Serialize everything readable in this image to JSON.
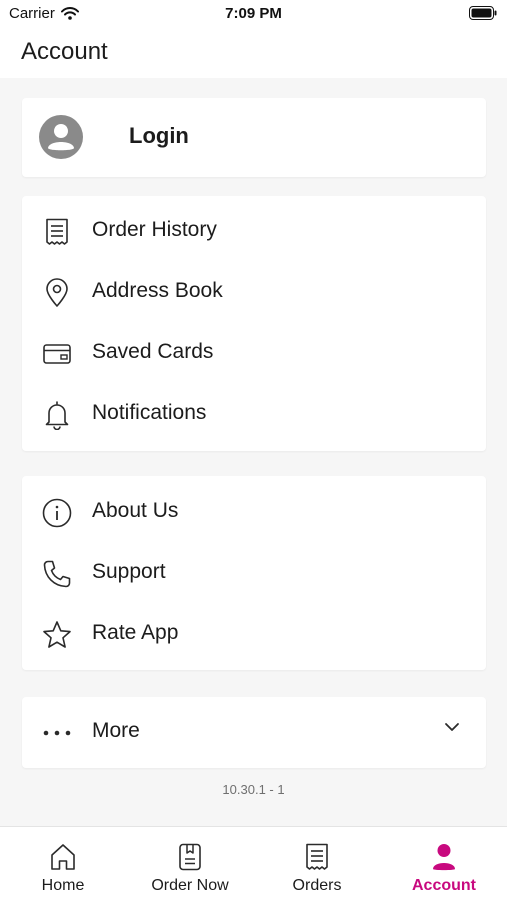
{
  "status_bar": {
    "carrier": "Carrier",
    "time": "7:09 PM"
  },
  "header": {
    "title": "Account"
  },
  "login": {
    "label": "Login"
  },
  "menu_group_1": [
    {
      "label": "Order History",
      "icon": "receipt-icon"
    },
    {
      "label": "Address Book",
      "icon": "location-pin-icon"
    },
    {
      "label": "Saved Cards",
      "icon": "credit-card-icon"
    },
    {
      "label": "Notifications",
      "icon": "bell-icon"
    }
  ],
  "menu_group_2": [
    {
      "label": "About Us",
      "icon": "info-icon"
    },
    {
      "label": "Support",
      "icon": "phone-icon"
    },
    {
      "label": "Rate App",
      "icon": "star-icon"
    }
  ],
  "more": {
    "label": "More",
    "icon": "ellipsis-icon"
  },
  "version": "10.30.1 - 1",
  "tabs": [
    {
      "label": "Home",
      "icon": "home-icon",
      "active": false
    },
    {
      "label": "Order Now",
      "icon": "menu-book-icon",
      "active": false
    },
    {
      "label": "Orders",
      "icon": "receipt-icon",
      "active": false
    },
    {
      "label": "Account",
      "icon": "person-icon",
      "active": true
    }
  ],
  "colors": {
    "accent": "#c8097f",
    "background": "#f6f6f6",
    "card": "#ffffff",
    "text": "#1c1c1c"
  }
}
